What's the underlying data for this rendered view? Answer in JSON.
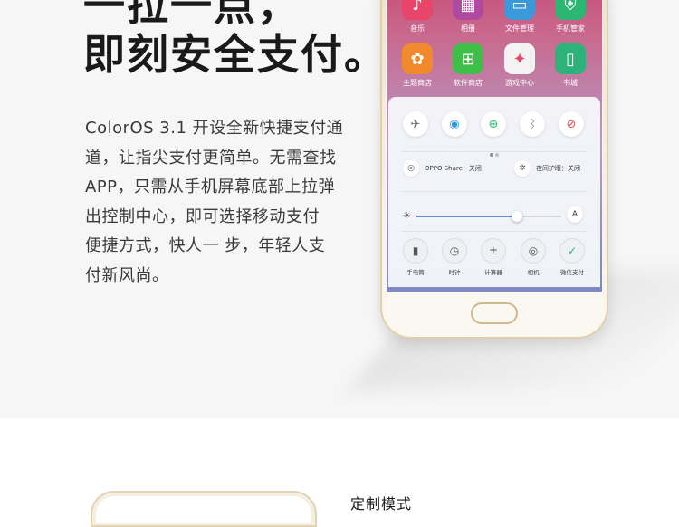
{
  "headline": {
    "line1": "一拉一点，",
    "line2": "即刻安全支付。"
  },
  "description": {
    "lines": [
      "ColorOS 3.1 开设全新快捷支付通",
      "道，让指尖支付更简单。无需查找",
      "APP，只需从手机屏幕底部上拉弹",
      "出控制中心，即可选择移动支付",
      "便捷方式，快人一 步，年轻人支",
      "付新风尚。"
    ]
  },
  "phone": {
    "apps_row1": [
      {
        "label": "音乐",
        "icon": "music-icon",
        "color": "#e8456b"
      },
      {
        "label": "相册",
        "icon": "gallery-icon",
        "color": "#b04aa0"
      },
      {
        "label": "文件管理",
        "icon": "folder-icon",
        "color": "#3a9ad9"
      },
      {
        "label": "手机管家",
        "icon": "shield-icon",
        "color": "#2bb673"
      }
    ],
    "apps_row2": [
      {
        "label": "主题商店",
        "icon": "palette-icon",
        "color": "#f08a2c"
      },
      {
        "label": "软件商店",
        "icon": "app-store-icon",
        "color": "#3fbf4a"
      },
      {
        "label": "游戏中心",
        "icon": "game-center-icon",
        "color": "#f3f3f3"
      },
      {
        "label": "书城",
        "icon": "book-icon",
        "color": "#2db37a"
      }
    ],
    "control_center": {
      "toggles": [
        {
          "icon": "airplane-icon",
          "glyph": "✈",
          "color": "#555555"
        },
        {
          "icon": "wifi-icon",
          "glyph": "◉",
          "color": "#2f9be0"
        },
        {
          "icon": "network-icon",
          "glyph": "⊕",
          "color": "#2bb673"
        },
        {
          "icon": "bluetooth-icon",
          "glyph": "ᛒ",
          "color": "#666666"
        },
        {
          "icon": "rotation-lock-icon",
          "glyph": "🔒",
          "color": "#e24b4b"
        }
      ],
      "oppo_share": "OPPO Share：关闭",
      "night_mode": "夜间护眼：关闭",
      "brightness_auto": "A",
      "shortcuts": [
        {
          "label": "手电筒",
          "icon": "flashlight-icon",
          "glyph": "▮"
        },
        {
          "label": "时钟",
          "icon": "clock-icon",
          "glyph": "◷"
        },
        {
          "label": "计算器",
          "icon": "calculator-icon",
          "glyph": "±"
        },
        {
          "label": "相机",
          "icon": "camera-icon",
          "glyph": "◎"
        },
        {
          "label": "微信支付",
          "icon": "wechat-pay-icon",
          "glyph": "✓"
        }
      ]
    }
  },
  "next_section": {
    "title": "定制模式"
  }
}
